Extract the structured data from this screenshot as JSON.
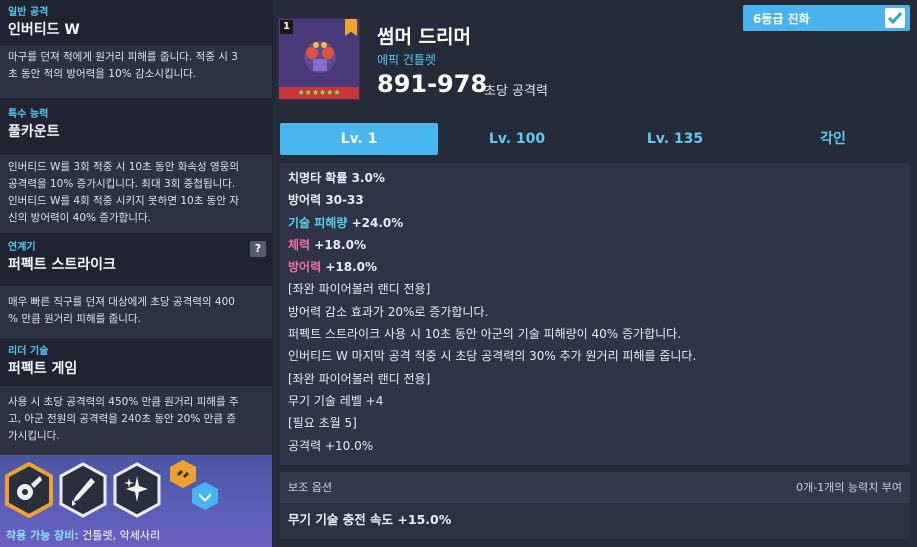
{
  "left_panel": {
    "sections": [
      {
        "category": "일반 공격",
        "title": "인버티드 W",
        "desc": [
          "마구를 던져 적에게 원거리 피해를 줍니다. 적중 시 3",
          "초 동안 적의 방어력을 10% 감소시킵니다."
        ]
      },
      {
        "category": "특수 능력",
        "title": "풀카운트",
        "desc": [
          "인버티드 W를 3회 적중 시 10초 동안 화속성 영웅의",
          "공격력을 10% 증가시킵니다. 최대 3회 중첩됩니다.",
          "인버티드 W를 4회 적중 시키지 못하면 10초 동안 자",
          "신의 방어력이 40% 증가합니다."
        ]
      },
      {
        "category": "연계기",
        "title": "퍼펙트 스트라이크",
        "help": "?",
        "desc": [
          "매우 빠른 직구를 던져 대상에게 초당 공격력의 400",
          "% 만큼 원거리 피해를 줍니다."
        ]
      },
      {
        "category": "리더 기술",
        "title": "퍼펙트 게임",
        "desc": [
          "사용 시 초당 공격력의 450% 만큼 원거리 피해를 주",
          "고, 아군 전원의 공격력을 240초 동안 20% 만큼 증",
          "가시킵니다."
        ]
      }
    ],
    "equip_label": "착용 가능 장비:",
    "equip_value": "건틀렛, 악세사리"
  },
  "item": {
    "level_badge": "1",
    "name": "썸머 드리머",
    "rarity": "에픽 건틀렛",
    "atk": "891-978",
    "atk_label": "초당 공격력",
    "evolve_label": "6등급 진화",
    "stars": "★★★★★★"
  },
  "tabs": [
    "Lv. 1",
    "Lv. 100",
    "Lv. 135",
    "각인"
  ],
  "stats": {
    "crit": {
      "k": "치명타 확률",
      "v": "3.0%"
    },
    "def": {
      "k": "방어력",
      "v": "30-33"
    },
    "skill_dmg": {
      "k": "기술 피해량",
      "v": "+24.0%"
    },
    "hp": {
      "k": "체력",
      "v": "+18.0%"
    },
    "def2": {
      "k": "방어력",
      "v": "+18.0%"
    },
    "lines": [
      "[좌완 파이어볼러 랜디 전용]",
      "방어력 감소 효과가 20%로 증가합니다.",
      "퍼펙트 스트라이크 사용 시 10초 동안 아군의 기술 피해량이 40% 증가합니다.",
      "인버티드 W 마지막 공격 적중 시 초당 공격력의 30% 추가 원거리 피해를 줍니다.",
      "[좌완 파이어볼러 랜디 전용]",
      "무기 기술 레벨 +4",
      "[필요 초월 5]",
      "공격력 +10.0%"
    ]
  },
  "sub_options": {
    "title": "보조 옵션",
    "right_text": "0개-1개의 능력치 부여",
    "line": "무기 기술 충전 속도 +15.0%"
  },
  "colors": {
    "accent": "#49b6ee",
    "cyan_text": "#5ecbf2",
    "pink_text": "#f06fa4",
    "hex_orange": "#f0a030"
  }
}
